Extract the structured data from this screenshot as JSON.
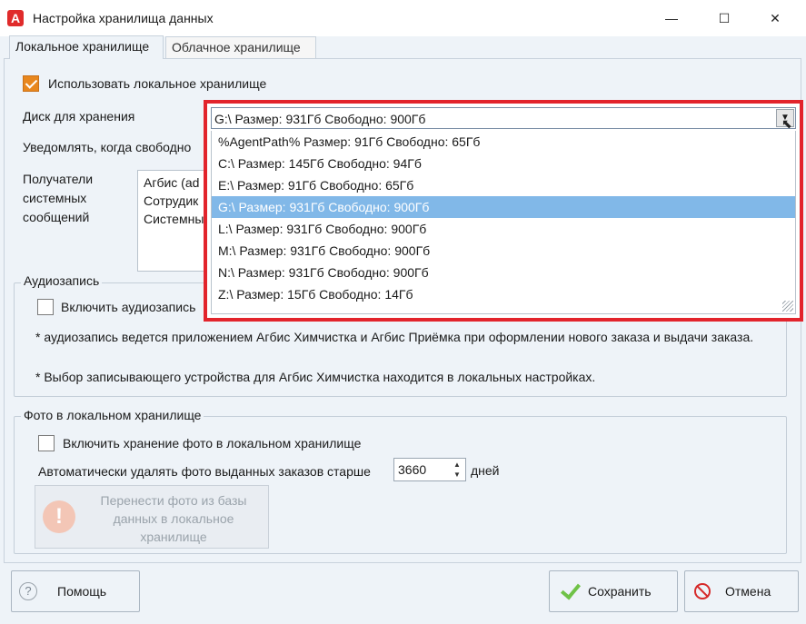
{
  "window": {
    "app_icon": "A",
    "title": "Настройка хранилища данных",
    "minimize": "—",
    "maximize": "☐",
    "close": "✕"
  },
  "tabs": [
    {
      "label": "Локальное хранилище",
      "active": true
    },
    {
      "label": "Облачное хранилище",
      "active": false
    }
  ],
  "local": {
    "use_local_label": "Использовать локальное хранилище",
    "use_local_checked": true,
    "disk_label": "Диск для хранения",
    "notify_label": "Уведомлять, когда свободно",
    "recipients_label_lines": [
      "Получатели",
      "системных",
      "сообщений"
    ],
    "recipients": [
      "Агбис (ad",
      "Сотрудик",
      "Системны"
    ]
  },
  "disk_dropdown": {
    "selected": "G:\\ Размер: 931Гб Свободно: 900Гб",
    "options": [
      "%AgentPath% Размер: 91Гб Свободно: 65Гб",
      "C:\\ Размер: 145Гб Свободно: 94Гб",
      "E:\\ Размер: 91Гб Свободно: 65Гб",
      "G:\\ Размер: 931Гб Свободно: 900Гб",
      "L:\\ Размер: 931Гб Свободно: 900Гб",
      "M:\\ Размер: 931Гб Свободно: 900Гб",
      "N:\\ Размер: 931Гб Свободно: 900Гб",
      "Z:\\ Размер: 15Гб Свободно: 14Гб"
    ],
    "highlighted_index": 3
  },
  "audio": {
    "group_title": "Аудиозапись",
    "enable_label": "Включить аудиозапись",
    "enable_checked": false,
    "note1": "* аудиозапись ведется приложением Агбис Химчистка и Агбис Приёмка при оформлении нового заказа и выдачи заказа.",
    "note2": "* Выбор записывающего устройства для Агбис Химчистка находится в локальных настройках."
  },
  "photo": {
    "group_title": "Фото в локальном хранилище",
    "enable_label": "Включить хранение фото в локальном хранилище",
    "enable_checked": false,
    "auto_delete_label": "Автоматически удалять фото выданных заказов старше",
    "days_value": "3660",
    "days_unit": "дней",
    "migrate_button": "Перенести фото из базы данных в локальное хранилище",
    "warning_icon": "!"
  },
  "footer": {
    "help": "Помощь",
    "save": "Сохранить",
    "cancel": "Отмена",
    "help_icon": "?"
  },
  "icons": [
    "app-logo-icon",
    "help-icon",
    "checkmark-icon",
    "cancel-icon",
    "warning-icon",
    "dropdown-arrow-icon"
  ],
  "colors": {
    "highlight_frame": "#e2242c",
    "selection": "#81b8e8",
    "checkbox_checked": "#e8871e"
  }
}
